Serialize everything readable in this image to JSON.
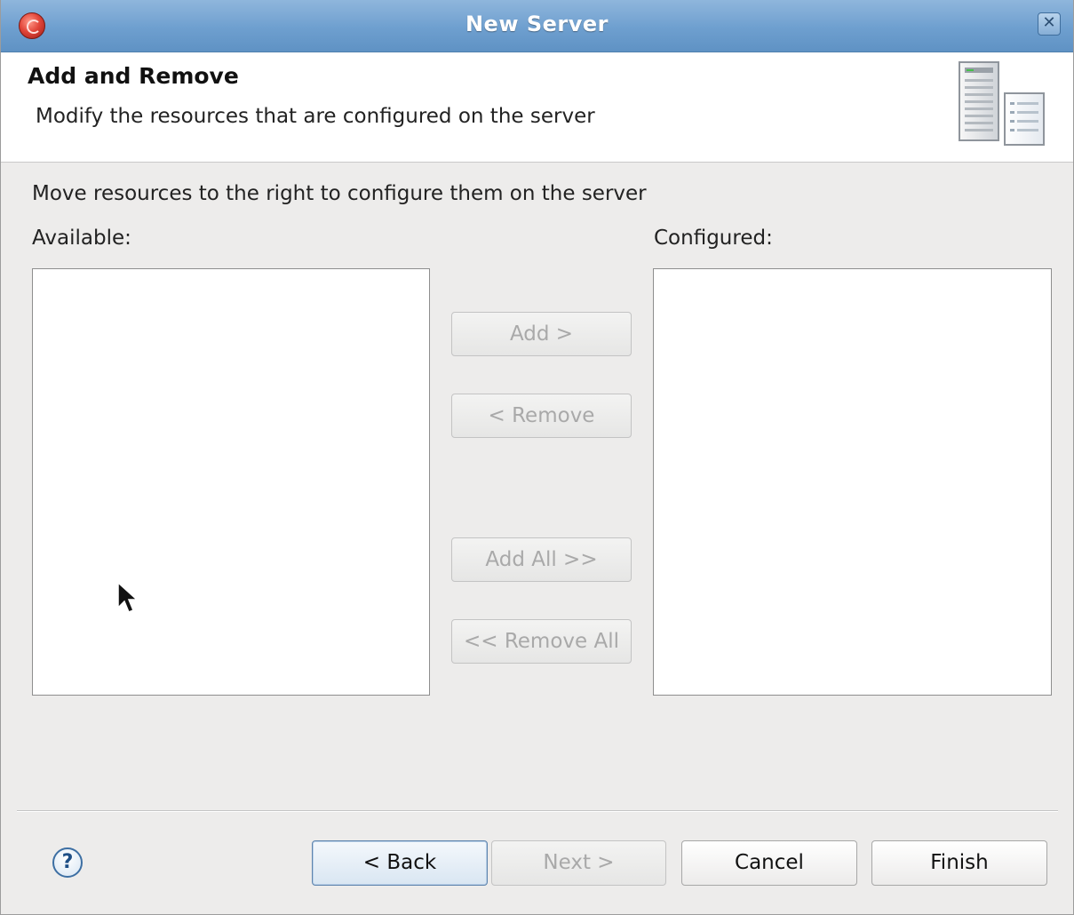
{
  "window": {
    "title": "New Server",
    "close_glyph": "✕",
    "app_icon": "eclipse-redhat-icon"
  },
  "header": {
    "title": "Add and Remove",
    "description": "Modify the resources that are configured on the server",
    "banner_icon": "server-icon"
  },
  "body": {
    "instruction": "Move resources to the right to configure them on the server",
    "available_label": "Available:",
    "configured_label": "Configured:",
    "available_items": [],
    "configured_items": []
  },
  "transfer_buttons": {
    "add": "Add >",
    "remove": "< Remove",
    "add_all": "Add All >>",
    "remove_all": "<< Remove All"
  },
  "footer": {
    "help_glyph": "?",
    "back": "< Back",
    "next": "Next >",
    "cancel": "Cancel",
    "finish": "Finish"
  },
  "colors": {
    "titlebar": "#6e9fcf",
    "dialog_bg": "#edeceb",
    "disabled_text": "#a9a9a9"
  }
}
